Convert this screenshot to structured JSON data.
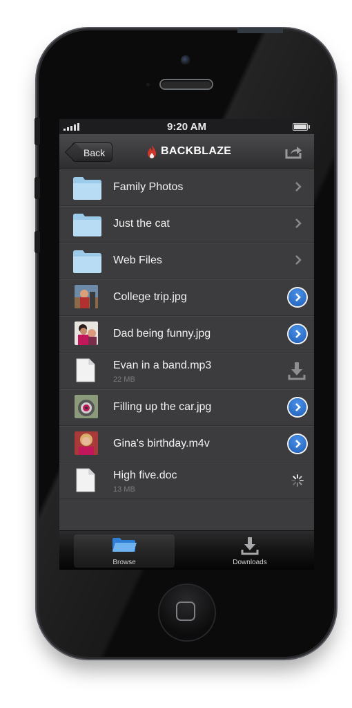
{
  "status_bar": {
    "time": "9:20 AM"
  },
  "nav": {
    "back_label": "Back",
    "brand_prefix": "BACK",
    "brand_suffix": "BLAZE"
  },
  "files": [
    {
      "name": "Family Photos",
      "type": "folder",
      "accessory": "chevron"
    },
    {
      "name": "Just the cat",
      "type": "folder",
      "accessory": "chevron"
    },
    {
      "name": "Web Files",
      "type": "folder",
      "accessory": "chevron"
    },
    {
      "name": "College trip.jpg",
      "type": "photo",
      "accessory": "disclosure"
    },
    {
      "name": "Dad being funny.jpg",
      "type": "photo",
      "accessory": "disclosure"
    },
    {
      "name": "Evan in a band.mp3",
      "type": "document",
      "size": "22 MB",
      "accessory": "download"
    },
    {
      "name": "Filling up the car.jpg",
      "type": "photo",
      "accessory": "disclosure"
    },
    {
      "name": "Gina's birthday.m4v",
      "type": "photo",
      "accessory": "disclosure"
    },
    {
      "name": "High five.doc",
      "type": "document",
      "size": "13 MB",
      "accessory": "spinner"
    }
  ],
  "tabs": [
    {
      "label": "Browse",
      "icon": "folder-icon",
      "active": true
    },
    {
      "label": "Downloads",
      "icon": "download-icon",
      "active": false
    }
  ],
  "colors": {
    "accent_blue": "#2a6fd0",
    "brand_red": "#d0352a"
  }
}
